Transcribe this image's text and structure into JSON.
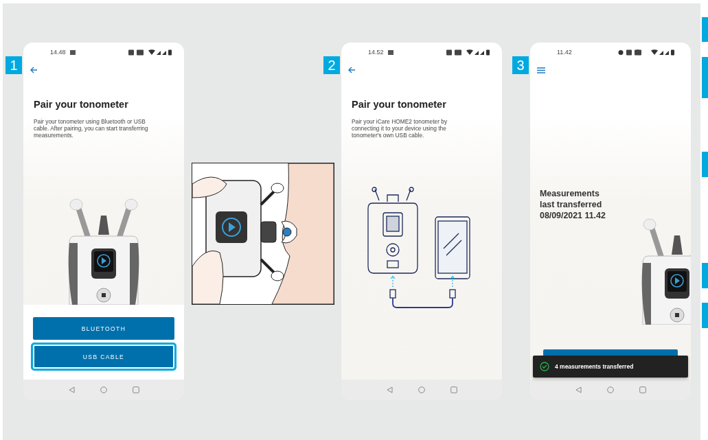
{
  "steps": [
    {
      "number": "1",
      "kind": "choice",
      "time": "14.48",
      "alarm": false,
      "nav": {
        "kind": "back"
      },
      "title": "Pair your tonometer",
      "description": "Pair your tonometer using Bluetooth or USB cable. After pairing, you can start transferring measurements.",
      "buttons": [
        {
          "label": "BLUETOOTH",
          "selected": false
        },
        {
          "label": "USB CABLE",
          "selected": true
        }
      ]
    },
    {
      "number": "2",
      "kind": "cable",
      "time": "14.52",
      "alarm": false,
      "nav": {
        "kind": "back"
      },
      "title": "Pair your tonometer",
      "description": "Pair your iCare HOME2 tonometer by connecting it to your device using the tonometer's own USB cable."
    },
    {
      "number": "3",
      "kind": "summary",
      "time": "11.42",
      "alarm": true,
      "nav": {
        "kind": "menu"
      },
      "headline": [
        "Measurements",
        "last transferred",
        "08/09/2021 11.42"
      ],
      "toast": "4 measurements transferred"
    }
  ]
}
